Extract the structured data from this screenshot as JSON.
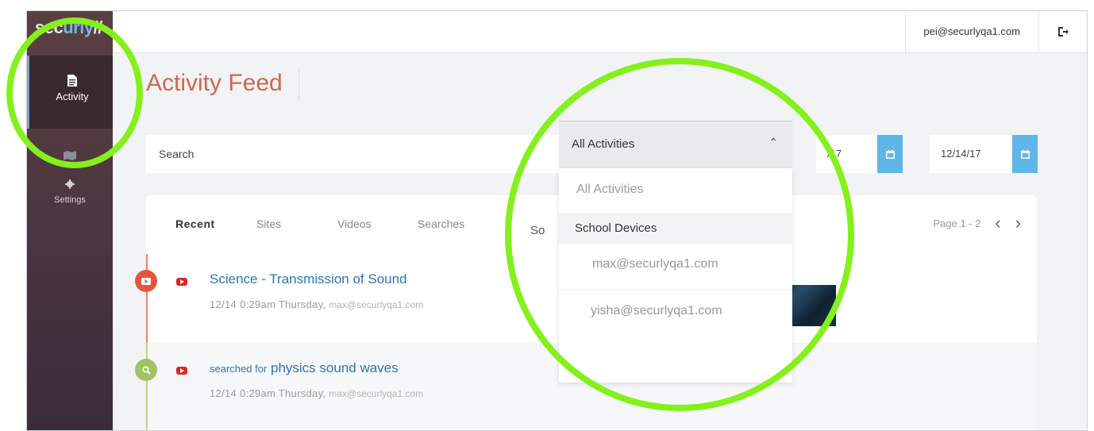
{
  "app": {
    "logo_text": "securly//",
    "user_email": "pei@securlyqa1.com"
  },
  "sidebar": {
    "items": [
      {
        "label": "Activity",
        "icon": "document-icon",
        "active": true
      },
      {
        "label": "",
        "icon": "map-icon",
        "active": false
      },
      {
        "label": "Settings",
        "icon": "gear-icon",
        "active": false
      }
    ]
  },
  "header": {
    "title": "Activity Feed"
  },
  "filters": {
    "search_placeholder": "Search",
    "activity_select": "All Activities",
    "start_date": "/17",
    "end_date": "12/14/17"
  },
  "dropdown": {
    "options": [
      "All Activities",
      "School Devices",
      "max@securlyqa1.com",
      "yisha@securlyqa1.com"
    ]
  },
  "feed": {
    "tabs": [
      "Recent",
      "Sites",
      "Videos",
      "Searches",
      "So"
    ],
    "pager": {
      "text": "Page 1 - 2",
      "prev": "‹",
      "next": "›"
    },
    "items": [
      {
        "type": "video",
        "title": "Science - Transmission of Sound",
        "time": "12/14 0:29am Thursday,",
        "user": "max@securlyqa1.com"
      },
      {
        "type": "search",
        "prefix": "searched for",
        "query": "physics sound waves",
        "time": "12/14 0:29am Thursday,",
        "user": "max@securlyqa1.com"
      }
    ]
  },
  "colors": {
    "accent_title": "#d2664d",
    "link_blue": "#2d75b5",
    "highlight_ring": "#84f01c",
    "calendar_button": "#5fb6e8",
    "video_badge": "#e0573e",
    "search_badge": "#a3c265"
  }
}
